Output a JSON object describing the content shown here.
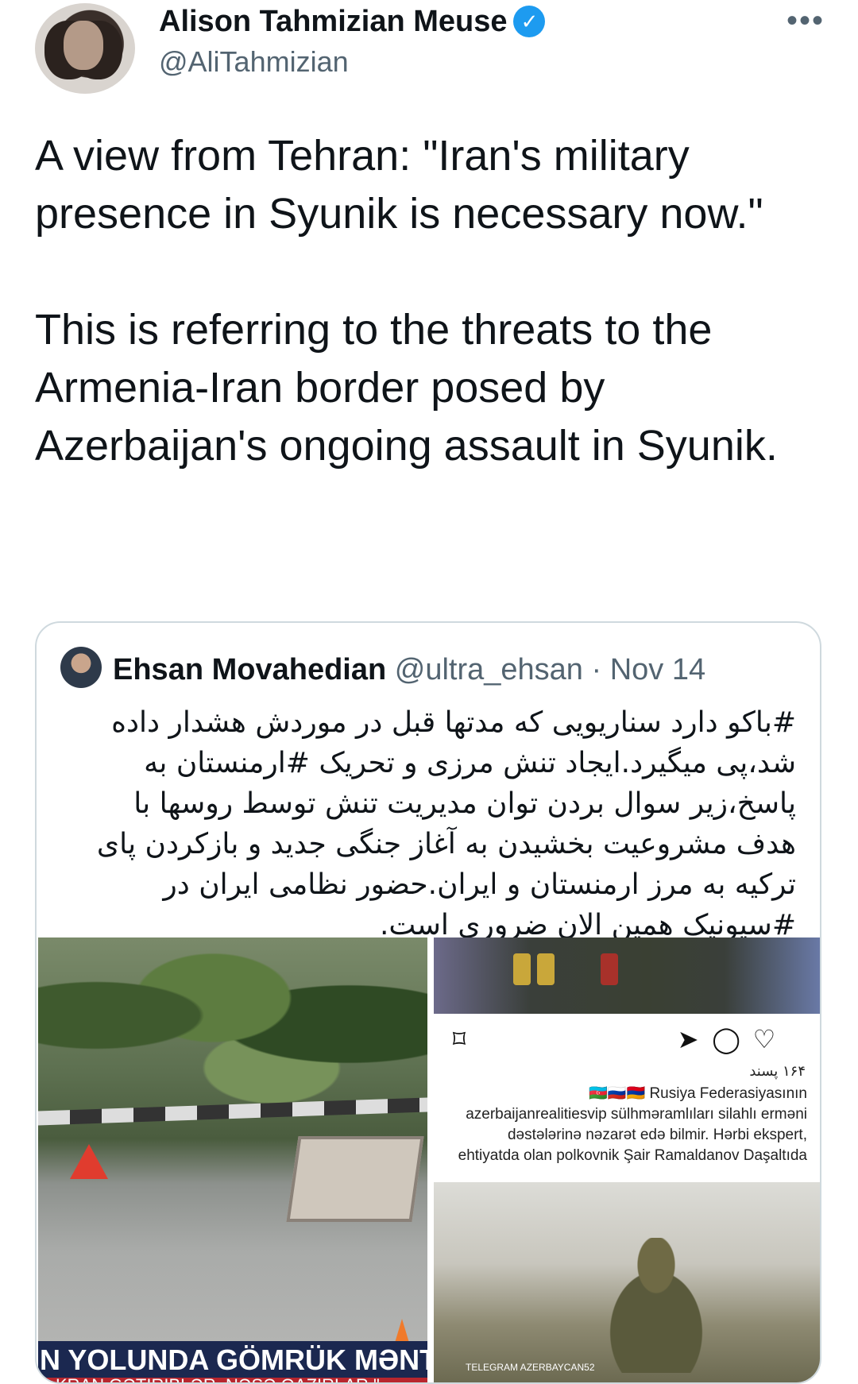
{
  "author": {
    "name": "Alison Tahmizian Meuse",
    "handle": "@AliTahmizian",
    "verified_symbol": "✓"
  },
  "more_symbol": "•••",
  "tweet_text": "A view from Tehran: \"Iran's military presence in Syunik is necessary now.\"\n\nThis is referring to the threats to the Armenia-Iran border posed by Azerbaijan's ongoing assault in Syunik.",
  "quote": {
    "name": "Ehsan Movahedian",
    "meta": "@ultra_ehsan · Nov 14",
    "text": "#باکو دارد سناریویی که مدتها قبل در موردش هشدار داده شد،پی میگیرد.ایجاد تنش مرزی و تحریک #ارمنستان به پاسخ،زیر سوال بردن توان مدیریت تنش توسط روسها با هدف مشروعیت بخشیدن به آغاز جنگی جدید و بازکردن پای ترکیه به مرز ارمنستان و ایران.حضور نظامی ایران در #سیونیک همین الان ضروری است."
  },
  "media": {
    "left_caption_line1": "N YOLUNDA GÖMRÜK MƏNTƏQƏ",
    "left_caption_line2": "R KRAN GƏTİRİBLƏR. NƏSƏ OAZIRLAR \"",
    "ig_likes": "۱۶۴ پسند",
    "ig_caption": "🇦🇿🇷🇺🇦🇲 Rusiya Federasiyasının azerbaijanrealitiesvip sülhməramlıları silahlı erməni dəstələrinə nəzarət edə bilmir. Hərbi ekspert, ehtiyatda olan polkovnik Şair Ramaldanov Daşaltıda baş veran terror aktına",
    "tg_label": "TELEGRAM AZERBAYCAN52",
    "icons": [
      "bookmark-icon",
      "send-icon",
      "comment-icon",
      "heart-icon"
    ]
  }
}
